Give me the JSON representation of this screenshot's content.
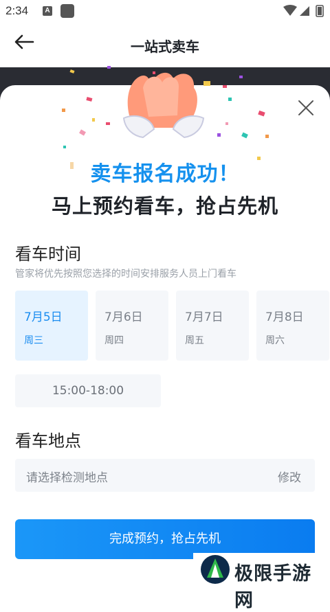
{
  "status_bar": {
    "time": "2:34",
    "a_icon_letter": "A"
  },
  "nav": {
    "title": "一站式卖车"
  },
  "success": {
    "title": "卖车报名成功！",
    "subtitle": "马上预约看车，抢占先机"
  },
  "viewing_time": {
    "title": "看车时间",
    "description": "管家将优先按照您选择的时间安排服务人员上门看车",
    "dates": [
      {
        "day": "7月5日",
        "weekday": "周三",
        "selected": true
      },
      {
        "day": "7月6日",
        "weekday": "周四",
        "selected": false
      },
      {
        "day": "7月7日",
        "weekday": "周五",
        "selected": false
      },
      {
        "day": "7月8日",
        "weekday": "周六",
        "selected": false
      }
    ],
    "time_slot": "15:00-18:00"
  },
  "viewing_location": {
    "title": "看车地点",
    "placeholder": "请选择检测地点",
    "edit_label": "修改"
  },
  "submit": {
    "label": "完成预约，抢占先机"
  },
  "watermark": {
    "text": "极限手游网"
  },
  "colors": {
    "accent": "#1591ee",
    "button": "#0a7cf0",
    "selected_bg": "#e6f3ff"
  }
}
